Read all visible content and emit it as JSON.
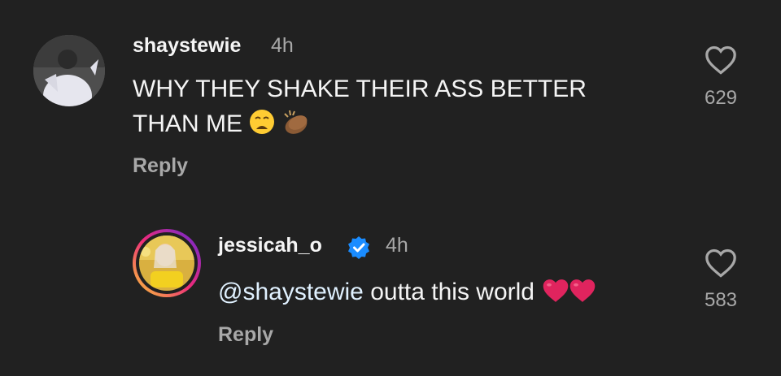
{
  "comments": [
    {
      "username": "shaystewie",
      "time": "4h",
      "text_line1": "WHY THEY SHAKE THEIR ASS BETTER",
      "text_line2": "THAN ME",
      "reply_label": "Reply",
      "likes": "629",
      "verified": false
    },
    {
      "username": "jessicah_o",
      "time": "4h",
      "mention": "@shaystewie",
      "text": " outta this world",
      "reply_label": "Reply",
      "likes": "583",
      "verified": true
    }
  ],
  "colors": {
    "background": "#212121",
    "verified": "#1a8cff",
    "story_ring_start": "#f9ce34",
    "story_ring_end": "#ee2a7b",
    "heart_red": "#e0245e"
  },
  "icons": [
    "heart-outline-icon",
    "verified-badge-icon",
    "weary-face-emoji",
    "clapping-hands-emoji",
    "red-heart-emoji"
  ]
}
